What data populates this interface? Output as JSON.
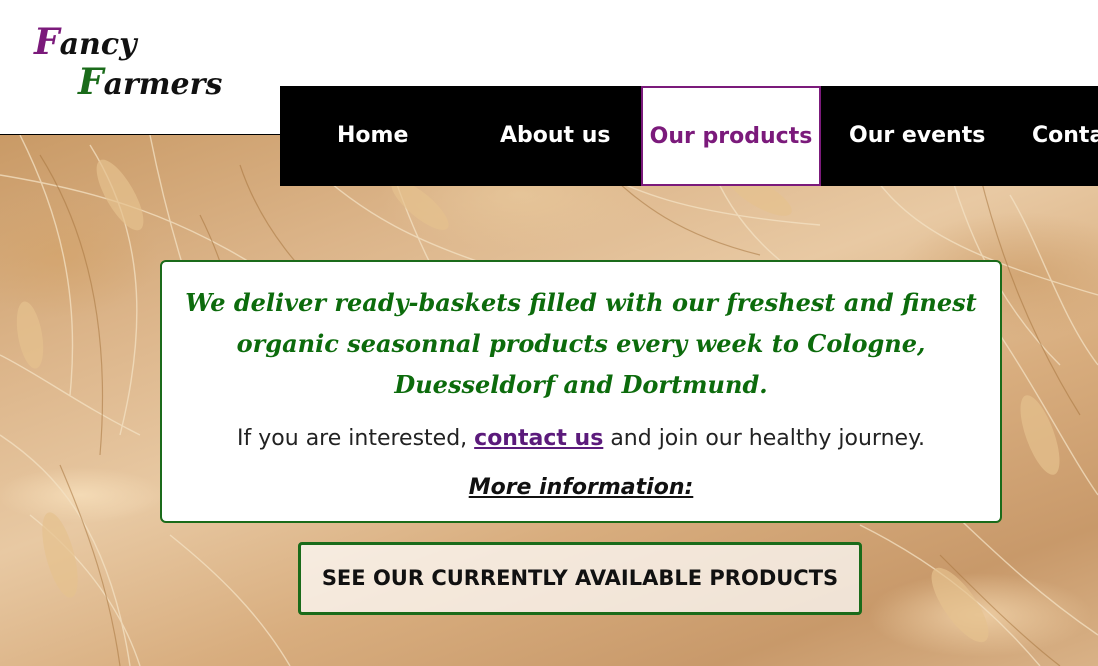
{
  "logo": {
    "line1_initial": "F",
    "line1_rest": "ancy",
    "line2_initial": "F",
    "line2_rest": "armers"
  },
  "nav": {
    "items": [
      {
        "label": "Home"
      },
      {
        "label": "About us"
      },
      {
        "label": "Our products",
        "active": true
      },
      {
        "label": "Our events"
      },
      {
        "label": "Contact"
      }
    ]
  },
  "hero": {
    "headline": "We deliver ready-baskets filled with our freshest and finest organic seasonnal products every week to Cologne, Duesseldorf and Dortmund.",
    "interest_before": "If you are interested,",
    "interest_link": "contact us",
    "interest_after": "and join our healthy journey.",
    "more_info": "More information:",
    "cta_label": "SEE OUR CURRENTLY AVAILABLE PRODUCTS"
  },
  "colors": {
    "brand_purple": "#7b1a7b",
    "brand_green": "#1a6b1a",
    "nav_background": "#000000"
  }
}
